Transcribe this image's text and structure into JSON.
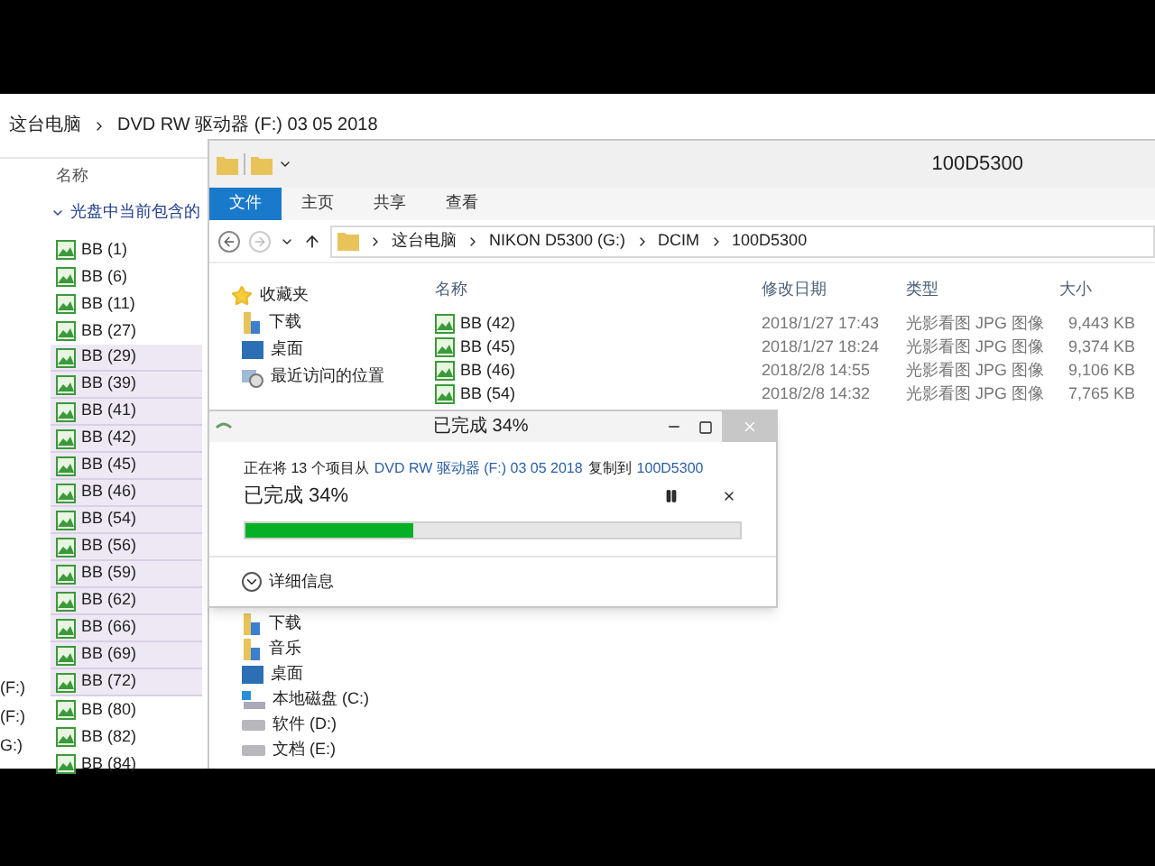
{
  "back_window": {
    "breadcrumb": [
      "这台电脑",
      "DVD RW 驱动器 (F:) 03 05 2018"
    ],
    "column_header": "名称",
    "group": "光盘中当前包含的",
    "files": [
      {
        "name": "BB (1)",
        "selected": false
      },
      {
        "name": "BB (6)",
        "selected": false
      },
      {
        "name": "BB (11)",
        "selected": false
      },
      {
        "name": "BB (27)",
        "selected": false
      },
      {
        "name": "BB (29)",
        "selected": true
      },
      {
        "name": "BB (39)",
        "selected": true
      },
      {
        "name": "BB (41)",
        "selected": true
      },
      {
        "name": "BB (42)",
        "selected": true
      },
      {
        "name": "BB (45)",
        "selected": true
      },
      {
        "name": "BB (46)",
        "selected": true
      },
      {
        "name": "BB (54)",
        "selected": true
      },
      {
        "name": "BB (56)",
        "selected": true
      },
      {
        "name": "BB (59)",
        "selected": true
      },
      {
        "name": "BB (62)",
        "selected": true
      },
      {
        "name": "BB (66)",
        "selected": true
      },
      {
        "name": "BB (69)",
        "selected": true
      },
      {
        "name": "BB (72)",
        "selected": true
      },
      {
        "name": "BB (80)",
        "selected": false
      },
      {
        "name": "BB (82)",
        "selected": false
      },
      {
        "name": "BB (84)",
        "selected": false
      }
    ],
    "nav_labels": [
      "(F:)",
      "(F:)",
      "G:)"
    ]
  },
  "front_window": {
    "title": "100D5300",
    "ribbon_tabs": [
      {
        "label": "文件",
        "selected": true
      },
      {
        "label": "主页",
        "selected": false
      },
      {
        "label": "共享",
        "selected": false
      },
      {
        "label": "查看",
        "selected": false
      }
    ],
    "address": [
      "这台电脑",
      "NIKON D5300 (G:)",
      "DCIM",
      "100D5300"
    ],
    "nav_top": [
      {
        "label": "收藏夹",
        "kind": "star"
      },
      {
        "label": "下载",
        "kind": "download"
      },
      {
        "label": "桌面",
        "kind": "desktop"
      },
      {
        "label": "最近访问的位置",
        "kind": "recent"
      }
    ],
    "columns": [
      "名称",
      "修改日期",
      "类型",
      "大小"
    ],
    "rows": [
      {
        "name": "BB (42)",
        "date": "2018/1/27 17:43",
        "type": "光影看图 JPG 图像",
        "size": "9,443 KB"
      },
      {
        "name": "BB (45)",
        "date": "2018/1/27 18:24",
        "type": "光影看图 JPG 图像",
        "size": "9,374 KB"
      },
      {
        "name": "BB (46)",
        "date": "2018/2/8 14:55",
        "type": "光影看图 JPG 图像",
        "size": "9,106 KB"
      },
      {
        "name": "BB (54)",
        "date": "2018/2/8 14:32",
        "type": "光影看图 JPG 图像",
        "size": "7,765 KB"
      }
    ],
    "nav_bottom": [
      {
        "label": "下载",
        "kind": "download"
      },
      {
        "label": "音乐",
        "kind": "music"
      },
      {
        "label": "桌面",
        "kind": "desktop"
      },
      {
        "label": "本地磁盘 (C:)",
        "kind": "system-drive"
      },
      {
        "label": "软件 (D:)",
        "kind": "drive"
      },
      {
        "label": "文档 (E:)",
        "kind": "drive"
      }
    ]
  },
  "dialog": {
    "title": "已完成 34%",
    "message": [
      {
        "text": "正在将 13 个项目从",
        "link": false
      },
      {
        "text": "DVD RW 驱动器 (F:) 03 05 2018",
        "link": true
      },
      {
        "text": "复制到",
        "link": false
      },
      {
        "text": "100D5300",
        "link": true
      }
    ],
    "progress_label": "已完成 34%",
    "level": 0.34,
    "details": "详细信息"
  }
}
